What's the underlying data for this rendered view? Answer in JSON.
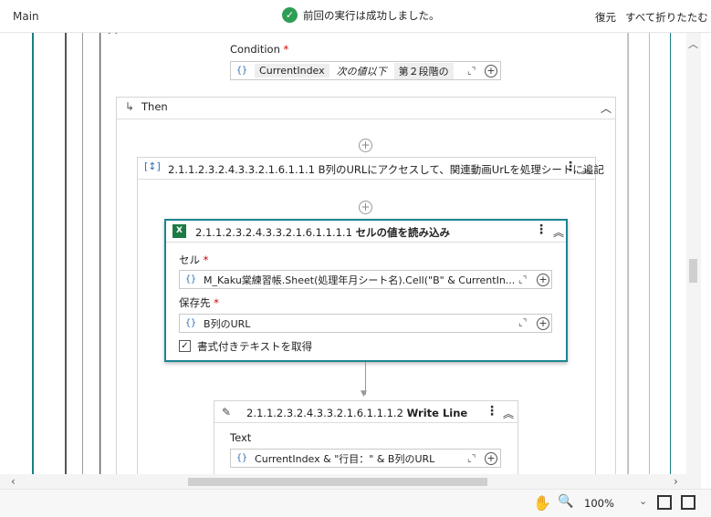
{
  "topbar": {
    "tab": "Main",
    "status": "前回の実行は成功しました。",
    "restore": "復元",
    "collapse_all": "すべて折りたたむ"
  },
  "condition": {
    "label": "Condition",
    "required": "*",
    "chip1": "CurrentIndex",
    "op": "次の値以下",
    "chip2": "第２段階の"
  },
  "then": {
    "label": "Then"
  },
  "sequence": {
    "title": "2.1.1.2.3.2.4.3.3.2.1.6.1.1.1 B列のURLにアクセスして、関連動画UrLを処理シートに追記"
  },
  "read_cell": {
    "id": "2.1.1.2.3.2.4.3.3.2.1.6.1.1.1.1",
    "name": "セルの値を読み込み",
    "cell_label": "セル",
    "cell_value": "M_Kaku棠練習帳.Sheet(処理年月シート名).Cell(\"B\" & CurrentIn...",
    "save_label": "保存先",
    "save_value": "B列のURL",
    "checkbox_label": "書式付きテキストを取得",
    "checkbox_checked": true
  },
  "write_line": {
    "id": "2.1.1.2.3.2.4.3.3.2.1.6.1.1.1.2",
    "name": "Write Line",
    "text_label": "Text",
    "text_value": "CurrentIndex & \"行目：\" & B列のURL"
  },
  "bottombar": {
    "zoom": "100%"
  },
  "colors": {
    "teal": "#1a7f80",
    "accent": "#1a8592",
    "success": "#2e9e55"
  }
}
